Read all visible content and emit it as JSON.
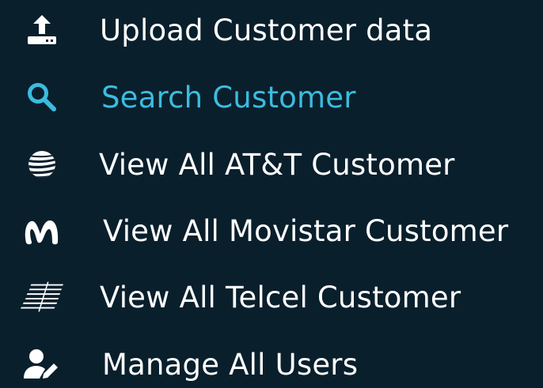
{
  "menu": {
    "items": [
      {
        "label": "Upload Customer data",
        "icon": "upload-icon"
      },
      {
        "label": "Search Customer",
        "icon": "search-icon",
        "active": true
      },
      {
        "label": "View All AT&T Customer",
        "icon": "att-globe-icon"
      },
      {
        "label": "View All Movistar Customer",
        "icon": "movistar-m-icon"
      },
      {
        "label": "View All Telcel Customer",
        "icon": "telcel-stripes-icon"
      },
      {
        "label": "Manage All Users",
        "icon": "user-edit-icon"
      }
    ]
  },
  "colors": {
    "background": "#0a1f2c",
    "text": "#ffffff",
    "active": "#3bbcdf"
  }
}
